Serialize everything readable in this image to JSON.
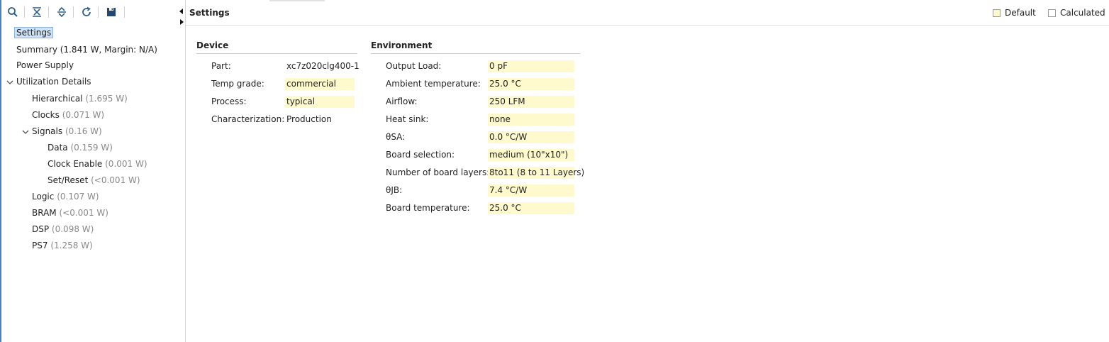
{
  "colors": {
    "default_bg": "#fffacd",
    "selection": "#cfe2f7",
    "accent_edge": "#4a7fc1"
  },
  "toolbar": {
    "icons": [
      "search-icon",
      "collapse-all-icon",
      "expand-all-icon",
      "refresh-icon",
      "save-icon"
    ]
  },
  "tree": {
    "settings": {
      "label": "Settings"
    },
    "summary": {
      "label": "Summary (1.841 W, Margin: N/A)"
    },
    "power_supply": {
      "label": "Power Supply"
    },
    "utilization": {
      "label": "Utilization Details"
    },
    "hierarchical": {
      "label": "Hierarchical",
      "value": "(1.695 W)"
    },
    "clocks": {
      "label": "Clocks",
      "value": "(0.071 W)"
    },
    "signals": {
      "label": "Signals",
      "value": "(0.16 W)"
    },
    "data": {
      "label": "Data",
      "value": "(0.159 W)"
    },
    "clock_enable": {
      "label": "Clock Enable",
      "value": "(0.001 W)"
    },
    "set_reset": {
      "label": "Set/Reset",
      "value": "(<0.001 W)"
    },
    "logic": {
      "label": "Logic",
      "value": "(0.107 W)"
    },
    "bram": {
      "label": "BRAM",
      "value": "(<0.001 W)"
    },
    "dsp": {
      "label": "DSP",
      "value": "(0.098 W)"
    },
    "ps7": {
      "label": "PS7",
      "value": "(1.258 W)"
    }
  },
  "header": {
    "title": "Settings",
    "legend_default": "Default",
    "legend_calculated": "Calculated"
  },
  "device": {
    "title": "Device",
    "part": {
      "label": "Part:",
      "value": "xc7z020clg400-1"
    },
    "temp_grade": {
      "label": "Temp grade:",
      "value": "commercial"
    },
    "process": {
      "label": "Process:",
      "value": "typical"
    },
    "characterization": {
      "label": "Characterization:",
      "value": "Production"
    }
  },
  "environment": {
    "title": "Environment",
    "output_load": {
      "label": "Output Load:",
      "value": "0 pF"
    },
    "ambient_temp": {
      "label": "Ambient temperature:",
      "value": "25.0 °C"
    },
    "airflow": {
      "label": "Airflow:",
      "value": "250 LFM"
    },
    "heat_sink": {
      "label": "Heat sink:",
      "value": "none"
    },
    "theta_sa": {
      "label": "θSA:",
      "value": "0.0 °C/W"
    },
    "board_selection": {
      "label": "Board selection:",
      "value": "medium (10\"x10\")"
    },
    "board_layers": {
      "label": "Number of board layers:",
      "value": "8to11 (8 to 11 Layers)"
    },
    "theta_jb": {
      "label": "θJB:",
      "value": "7.4 °C/W"
    },
    "board_temp": {
      "label": "Board temperature:",
      "value": "25.0 °C"
    }
  }
}
